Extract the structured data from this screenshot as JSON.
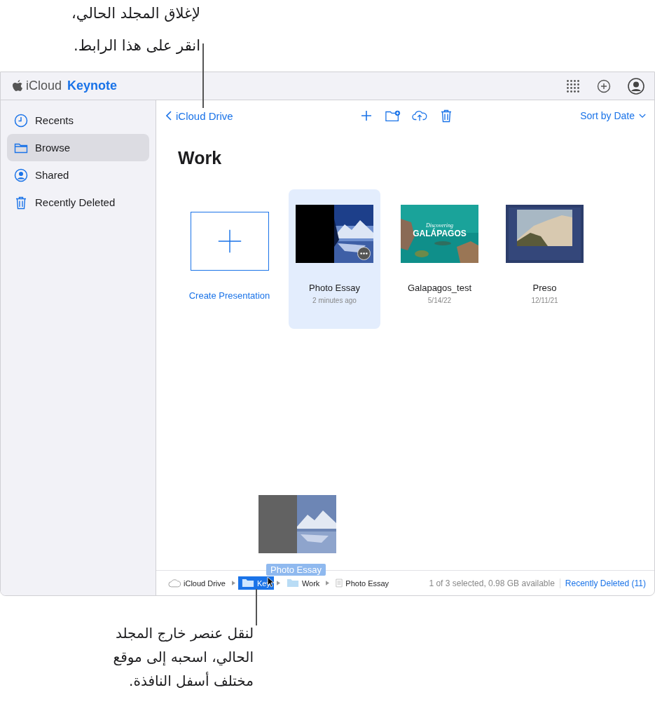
{
  "callouts": {
    "top": [
      "لإغلاق المجلد الحالي،",
      "انقر على هذا الرابط."
    ],
    "bottom": [
      "لنقل عنصر خارج المجلد",
      "الحالي، اسحبه إلى موقع",
      "مختلف أسفل النافذة."
    ]
  },
  "topbar": {
    "brand": "iCloud",
    "app": "Keynote"
  },
  "sidebar": {
    "items": [
      {
        "label": "Recents",
        "selected": false
      },
      {
        "label": "Browse",
        "selected": true
      },
      {
        "label": "Shared",
        "selected": false
      },
      {
        "label": "Recently Deleted",
        "selected": false
      }
    ]
  },
  "toolbar": {
    "back": "iCloud Drive",
    "sort": "Sort by Date"
  },
  "folder_title": "Work",
  "create": {
    "label": "Create Presentation"
  },
  "files": [
    {
      "name": "Photo Essay",
      "date": "2 minutes ago",
      "selected": true
    },
    {
      "name": "Galapagos_test",
      "date": "5/14/22",
      "selected": false,
      "thumb_kicker": "Discovering",
      "thumb_heading": "GALÁPAGOS"
    },
    {
      "name": "Preso",
      "date": "12/11/21",
      "selected": false
    }
  ],
  "drag": {
    "label": "Photo Essay"
  },
  "breadcrumbs": [
    {
      "label": "iCloud Drive",
      "kind": "cloud",
      "selected": false
    },
    {
      "label": "Key",
      "kind": "folder",
      "selected": true
    },
    {
      "label": "Work",
      "kind": "folder",
      "selected": false
    },
    {
      "label": "Photo Essay",
      "kind": "doc",
      "selected": false
    }
  ],
  "status": {
    "text": "1 of 3 selected, 0.98 GB available",
    "link": "Recently Deleted (11)"
  }
}
